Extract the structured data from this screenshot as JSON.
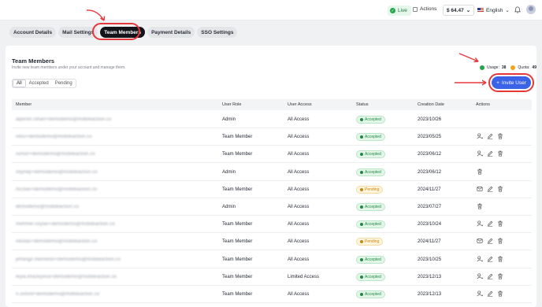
{
  "topbar": {
    "live": "Live",
    "actions": "Actions",
    "balance": "$ 64.47",
    "language": "English"
  },
  "tabs": [
    {
      "label": "Account Details",
      "active": false
    },
    {
      "label": "Mail Settings",
      "active": false
    },
    {
      "label": "Team Members",
      "active": true
    },
    {
      "label": "Payment Details",
      "active": false
    },
    {
      "label": "SSO Settings",
      "active": false
    }
  ],
  "section": {
    "title": "Team Members",
    "subtitle": "Invite new team members under your account and manage them.",
    "usage_label": "Usage:",
    "usage_value": "38",
    "quota_label": "Quota:",
    "quota_value": "49",
    "invite_label": "Invite User"
  },
  "filters": [
    "All",
    "Accepted",
    "Pending"
  ],
  "columns": [
    "Member",
    "User Role",
    "User Access",
    "Status",
    "Creation Date",
    "Actions"
  ],
  "rows": [
    {
      "email": "alperen.nihan+demodemo@mobileaction.co",
      "role": "Admin",
      "access": "All Access",
      "status": "Accepted",
      "date": "2023/10/26",
      "actions": []
    },
    {
      "email": "nilsu+demodemo@mobileaction.co",
      "role": "Team Member",
      "access": "All Access",
      "status": "Accepted",
      "date": "2023/05/25",
      "actions": [
        "transfer",
        "edit",
        "delete"
      ]
    },
    {
      "email": "sunun+demodemo@mobileaction.co",
      "role": "Team Member",
      "access": "All Access",
      "status": "Accepted",
      "date": "2023/06/12",
      "actions": [
        "transfer",
        "edit",
        "delete"
      ]
    },
    {
      "email": "zeynep+demodemo@mobileaction.co",
      "role": "Admin",
      "access": "All Access",
      "status": "Accepted",
      "date": "2023/06/12",
      "actions": [
        "delete"
      ]
    },
    {
      "email": "nicolas+demodemo@mobileaction.co",
      "role": "Team Member",
      "access": "All Access",
      "status": "Pending",
      "date": "2024/11/27",
      "actions": [
        "resend",
        "edit",
        "delete"
      ]
    },
    {
      "email": "demodemo@mobileaction.co",
      "role": "Admin",
      "access": "All Access",
      "status": "Accepted",
      "date": "2023/07/27",
      "actions": [
        "delete"
      ]
    },
    {
      "email": "mehmet.ceylan+demodemo@mobileaction.co",
      "role": "Team Member",
      "access": "All Access",
      "status": "Accepted",
      "date": "2023/10/24",
      "actions": [
        "transfer",
        "edit",
        "delete"
      ]
    },
    {
      "email": "nikolas+demodemo@mobileaction.co",
      "role": "Team Member",
      "access": "All Access",
      "status": "Pending",
      "date": "2024/11/27",
      "actions": [
        "resend",
        "edit",
        "delete"
      ]
    },
    {
      "email": "jehangir.memeton+demodemo@mobileaction.co",
      "role": "Team Member",
      "access": "All Access",
      "status": "Accepted",
      "date": "2023/10/25",
      "actions": [
        "transfer",
        "edit",
        "delete"
      ]
    },
    {
      "email": "leyla.khazeyeva+demodemo@mobileaction.co",
      "role": "Team Member",
      "access": "Limited Access",
      "status": "Accepted",
      "date": "2023/12/13",
      "actions": [
        "transfer",
        "edit",
        "delete"
      ]
    },
    {
      "email": "n.oxford+demodemo@mobileaction.co",
      "role": "Team Member",
      "access": "All Access",
      "status": "Accepted",
      "date": "2023/12/13",
      "actions": [
        "transfer",
        "edit",
        "delete"
      ]
    }
  ],
  "colors": {
    "accent": "#3b63e8",
    "annotation": "#e5383b",
    "accepted": "#1d8a43",
    "pending": "#c98a0c"
  }
}
